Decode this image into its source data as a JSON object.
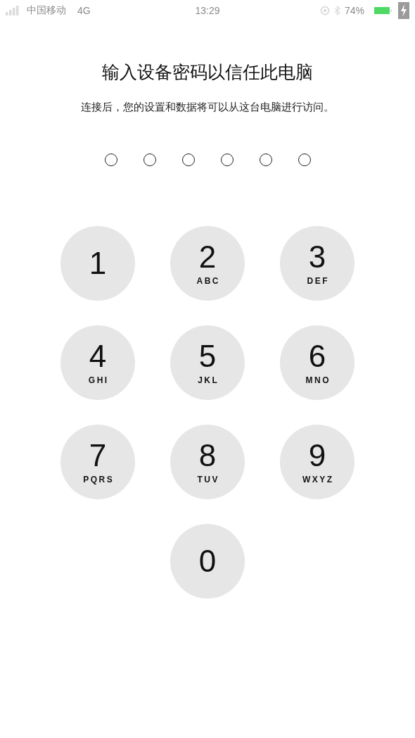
{
  "status_bar": {
    "carrier": "中国移动",
    "network": "4G",
    "time": "13:29",
    "battery": "74%"
  },
  "title": "输入设备密码以信任此电脑",
  "subtitle": "连接后，您的设置和数据将可以从这台电脑进行访问。",
  "passcode_dots": [
    {
      "filled": false
    },
    {
      "filled": false
    },
    {
      "filled": false
    },
    {
      "filled": false
    },
    {
      "filled": false
    },
    {
      "filled": false
    }
  ],
  "keys": [
    {
      "digit": "1"
    },
    {
      "digit": "2",
      "letters": "ABC"
    },
    {
      "digit": "3",
      "letters": "DEF"
    },
    {
      "digit": "4",
      "letters": "GHI"
    },
    {
      "digit": "5",
      "letters": "JKL"
    },
    {
      "digit": "6",
      "letters": "MNO"
    },
    {
      "digit": "7",
      "letters": "PQRS"
    },
    {
      "digit": "8",
      "letters": "TUV"
    },
    {
      "digit": "9",
      "letters": "WXYZ"
    },
    {
      "digit": "0"
    }
  ]
}
